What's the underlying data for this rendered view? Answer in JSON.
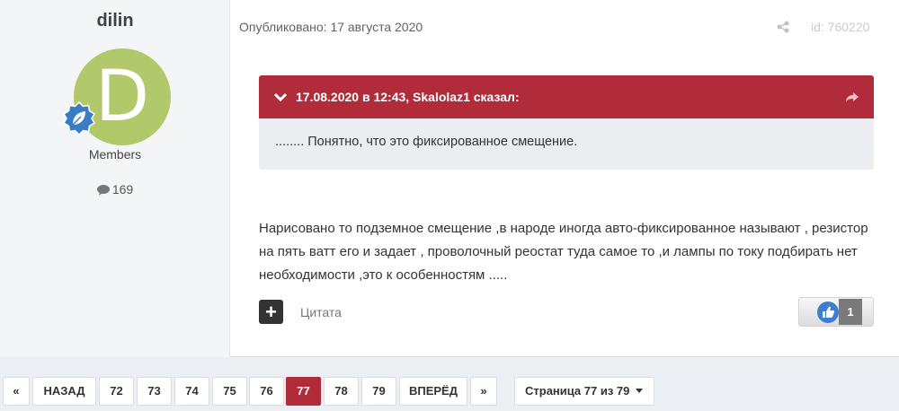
{
  "author": {
    "name": "dilin",
    "avatar_letter": "D",
    "avatar_color": "#b1c86b",
    "group": "Members",
    "post_count": "169",
    "badge_icon": "leaf-badge-icon"
  },
  "post": {
    "published": "Опубликовано: 17 августа 2020",
    "id_label": "id: 760220",
    "quote": {
      "header": "17.08.2020 в 12:43, Skalolaz1 сказал:",
      "text": "........ Понятно, что это фиксированное смещение."
    },
    "body": "Нарисовано то подземное смещение ,в народе иногда авто-фиксированное называют , резистор на пять ватт его и задает , проволочный реостат туда самое то ,и лампы по току подбирать нет необходимости ,это к особенностям .....",
    "quote_button": "Цитата",
    "multiquote_symbol": "+",
    "reaction_count": "1"
  },
  "pagination": {
    "prev_arrow": "«",
    "prev": "НАЗАД",
    "pages": [
      "72",
      "73",
      "74",
      "75",
      "76",
      "77",
      "78",
      "79"
    ],
    "current": "77",
    "next": "ВПЕРЁД",
    "next_arrow": "»",
    "page_of": "Страница 77 из 79"
  },
  "colors": {
    "accent": "#b02c3a",
    "quote_bg": "#ecedf0",
    "background": "#ebeef2"
  }
}
